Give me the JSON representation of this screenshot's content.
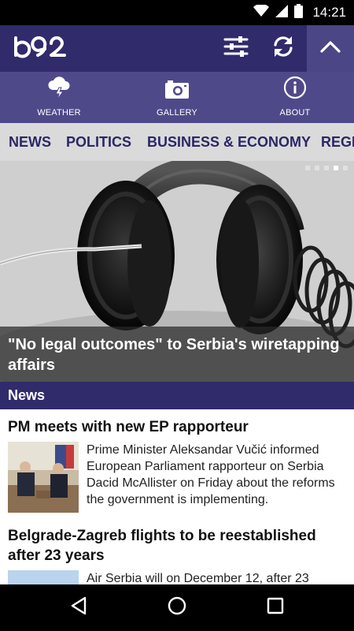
{
  "status_bar": {
    "time": "14:21",
    "icons": [
      "wifi-icon",
      "signal-icon",
      "battery-icon"
    ]
  },
  "app_bar": {
    "logo_text": "b92",
    "actions": [
      "settings-sliders-icon",
      "refresh-icon",
      "chevron-up-icon"
    ],
    "colors": {
      "primary": "#302b6b",
      "secondary": "#4e4a89"
    }
  },
  "quick_bar": {
    "items": [
      {
        "label": "WEATHER",
        "icon": "weather-storm-icon"
      },
      {
        "label": "GALLERY",
        "icon": "camera-icon"
      },
      {
        "label": "ABOUT",
        "icon": "info-icon"
      }
    ]
  },
  "categories": {
    "tabs": [
      "NEWS",
      "POLITICS",
      "BUSINESS & ECONOMY",
      "REGI"
    ]
  },
  "hero": {
    "caption": "\"No legal outcomes\" to Serbia's wiretapping affairs",
    "slide_count": 5,
    "active_slide": 4
  },
  "section": {
    "title": "News"
  },
  "articles": [
    {
      "title": "PM meets with new EP rapporteur",
      "summary": "Prime Minister Aleksandar Vučić informed European Parliament rapporteur on Serbia Dacid McAllister on Friday about the reforms the government is implementing."
    },
    {
      "title": "Belgrade-Zagreb flights to be reestablished after 23 years",
      "summary": "Air Serbia will on December 12, after 23"
    }
  ],
  "nav_bar": {
    "buttons": [
      "back-icon",
      "home-icon",
      "recents-icon"
    ]
  }
}
